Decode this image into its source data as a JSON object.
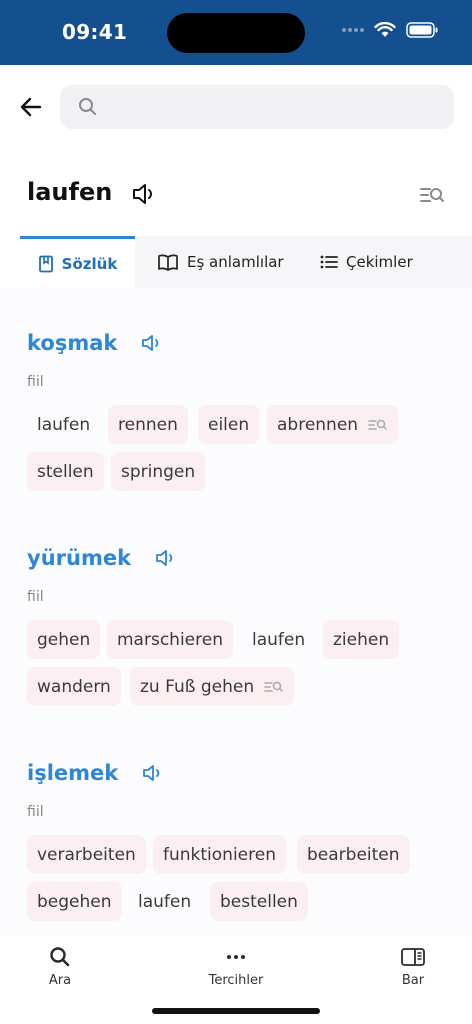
{
  "status_bar": {
    "time": "09:41"
  },
  "search": {
    "placeholder": "",
    "value": ""
  },
  "word": {
    "title": "laufen"
  },
  "tabs": [
    {
      "label": "Sözlük",
      "active": true
    },
    {
      "label": "Eş anlamlılar",
      "active": false
    },
    {
      "label": "Çekimler",
      "active": false
    }
  ],
  "senses": [
    {
      "word": "koşmak",
      "pos": "fiil",
      "synonyms": [
        "laufen",
        "rennen",
        "eilen",
        "abrennen",
        "stellen",
        "springen"
      ]
    },
    {
      "word": "yürümek",
      "pos": "fiil",
      "synonyms": [
        "gehen",
        "marschieren",
        "laufen",
        "ziehen",
        "wandern",
        "zu Fuß gehen"
      ]
    },
    {
      "word": "işlemek",
      "pos": "fiil",
      "synonyms": [
        "verarbeiten",
        "funktionieren",
        "bearbeiten",
        "begehen",
        "laufen",
        "bestellen"
      ]
    }
  ],
  "bottom_nav": [
    {
      "label": "Ara"
    },
    {
      "label": "Tercihler"
    },
    {
      "label": "Bar"
    }
  ],
  "colors": {
    "status_bar": "#14508f",
    "accent": "#2e86d6",
    "chip": "#fbeff2"
  }
}
